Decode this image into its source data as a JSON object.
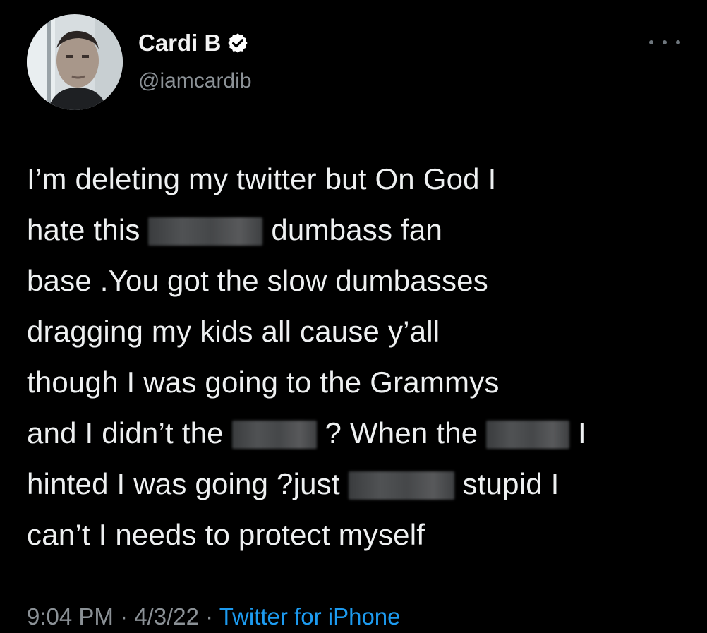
{
  "theme": {
    "background": "#000000",
    "text": "#eef0f1",
    "muted": "#8b9196",
    "link": "#1d9bf0",
    "verified_badge": "#ffffff"
  },
  "author": {
    "display_name": "Cardi B",
    "handle": "@iamcardib",
    "verified": true,
    "avatar": "profile-photo"
  },
  "tweet": {
    "lines": [
      [
        "I’m deleting my twitter but On God I"
      ],
      [
        "hate this ",
        "[redacted]",
        " dumbass fan"
      ],
      [
        "base .You got the slow dumbasses"
      ],
      [
        "dragging my kids all cause y’all"
      ],
      [
        "though I was going to the Grammys"
      ],
      [
        "and I didn’t the ",
        "[redacted]",
        " ? When the ",
        "[redacted]",
        " I"
      ],
      [
        "hinted I was going ?just ",
        "[redacted]",
        " stupid I"
      ],
      [
        "can’t I needs to protect myself"
      ]
    ]
  },
  "meta": {
    "time": "9:04 PM",
    "separator1": " · ",
    "date": "4/3/22",
    "separator2": " · ",
    "source": "Twitter for iPhone"
  }
}
